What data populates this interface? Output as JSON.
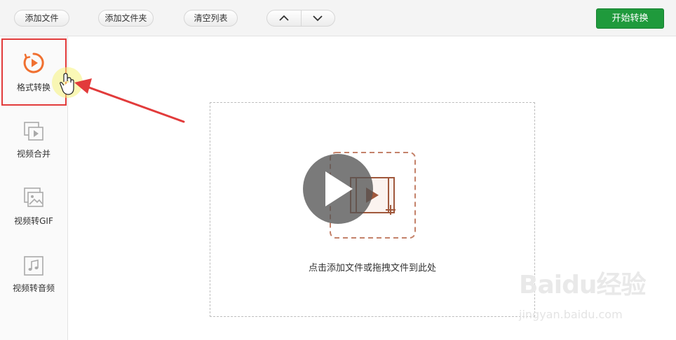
{
  "toolbar": {
    "add_file": "添加文件",
    "add_folder": "添加文件夹",
    "clear_list": "清空列表",
    "move_up_icon": "chevron-up-icon",
    "move_down_icon": "chevron-down-icon",
    "start_convert": "开始转换",
    "start_color": "#1f9a3c"
  },
  "sidebar": {
    "items": [
      {
        "label": "格式转换",
        "icon": "play-circle-icon",
        "active": true
      },
      {
        "label": "视频合并",
        "icon": "video-merge-icon"
      },
      {
        "label": "视频转GIF",
        "icon": "image-icon"
      },
      {
        "label": "视频转音频",
        "icon": "music-note-icon"
      }
    ],
    "accent": "#f07030"
  },
  "dropzone": {
    "hint": "点击添加文件或拖拽文件到此处",
    "icon": "add-video-icon"
  },
  "annotation": {
    "highlight_color": "#e23b3b",
    "overlay": "play-button-overlay"
  },
  "watermark": {
    "brand": "Baidu经验",
    "url": "jingyan.baidu.com"
  }
}
